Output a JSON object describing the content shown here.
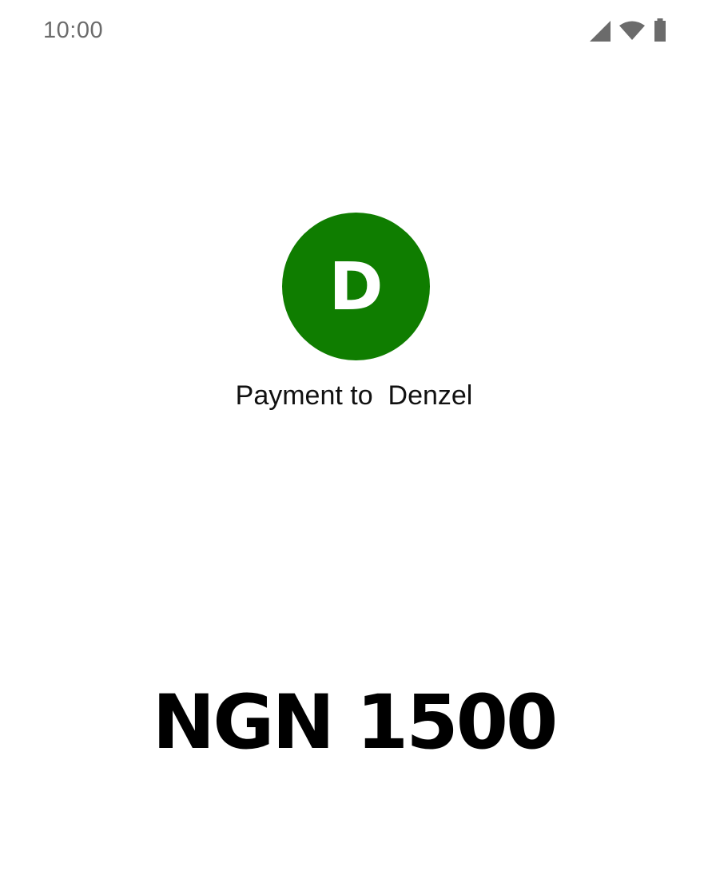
{
  "status_bar": {
    "time": "10:00",
    "icons": [
      "cellular-signal-icon",
      "wifi-icon",
      "battery-icon"
    ]
  },
  "payee": {
    "initial": "D",
    "label": "Payment to  Denzel",
    "avatar_color": "#0f7d00"
  },
  "amount": {
    "text": "NGN 1500"
  }
}
